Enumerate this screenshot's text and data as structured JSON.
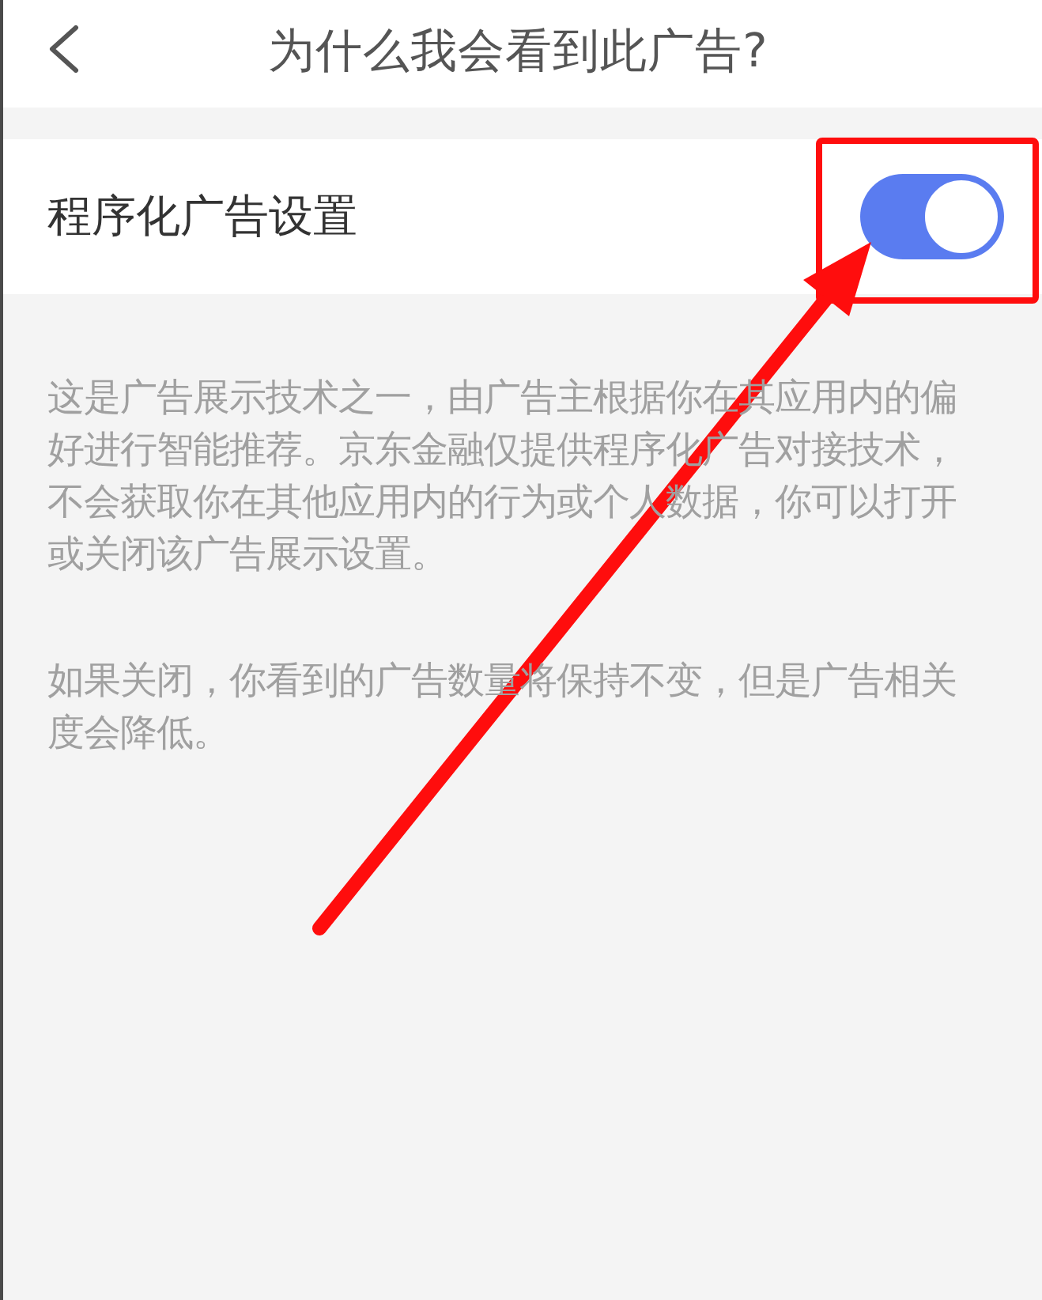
{
  "header": {
    "title": "为什么我会看到此广告?"
  },
  "setting": {
    "label": "程序化广告设置",
    "on": true
  },
  "description": [
    "这是广告展示技术之一，由广告主根据你在其应用内的偏好进行智能推荐。京东金融仅提供程序化广告对接技术，不会获取你在其他应用内的行为或个人数据，你可以打开或关闭该广告展示设置。",
    "如果关闭，你看到的广告数量将保持不变，但是广告相关度会降低。"
  ]
}
